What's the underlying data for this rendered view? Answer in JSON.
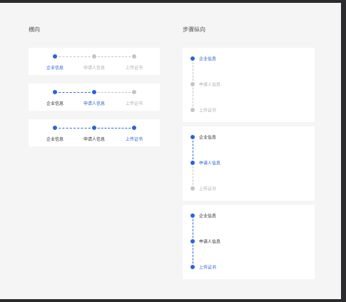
{
  "sections": {
    "horizontal_title": "横向",
    "vertical_title": "步骤纵向"
  },
  "steps": [
    "企业信息",
    "申请人信息",
    "上传证书"
  ],
  "colors": {
    "active": "#2c63d9",
    "done": "#333333",
    "pending": "#b0b0b0",
    "dot_pending": "#c4c4c4",
    "line_done": "#2c63d9",
    "line_pending": "#c4c4c4",
    "card_bg": "#ffffff",
    "page_bg": "#f5f5f5"
  },
  "horizontal_steppers": [
    {
      "current_step": 1,
      "states": [
        "active",
        "pending",
        "pending"
      ]
    },
    {
      "current_step": 2,
      "states": [
        "done",
        "active",
        "pending"
      ]
    },
    {
      "current_step": 3,
      "states": [
        "done",
        "done",
        "active"
      ]
    }
  ],
  "vertical_steppers": [
    {
      "current_step": 1,
      "states": [
        "active",
        "pending",
        "pending"
      ]
    },
    {
      "current_step": 2,
      "states": [
        "done",
        "active",
        "pending"
      ]
    },
    {
      "current_step": 3,
      "states": [
        "done",
        "done",
        "active"
      ]
    }
  ]
}
